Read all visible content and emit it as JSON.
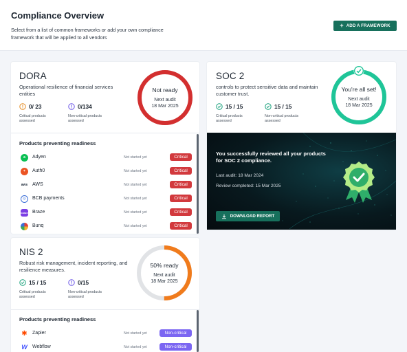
{
  "header": {
    "title": "Compliance Overview",
    "subtitle": "Select from a list of common frameworks or add your own compliance framework that will be applied to all vendors",
    "add_button": "ADD A FRAMEWORK"
  },
  "colors": {
    "accent": "#17705c",
    "critical": "#d2393d",
    "non_critical": "#7b66f2",
    "ring_red": "#d32f2f",
    "ring_green": "#1fc598",
    "ring_orange": "#f07b1c"
  },
  "frameworks": [
    {
      "name": "DORA",
      "description": "Operational resilience of financial services entities",
      "ring_status": "Not ready",
      "next_audit_label": "Next audit",
      "next_audit_date": "18 Mar 2025",
      "readiness": 0,
      "critical_value": "0/ 23",
      "critical_label": "Critical products assessed",
      "noncritical_value": "0/134",
      "noncritical_label": "Non-critical products assessed",
      "section_title": "Products preventing readiness",
      "products": [
        {
          "name": "Adyen",
          "status": "Not started yet",
          "badge": "Critical",
          "icon": "adyen-logo",
          "color": "#0abf53"
        },
        {
          "name": "Auth0",
          "status": "Not started yet",
          "badge": "Critical",
          "icon": "auth0-logo",
          "color": "#eb5424"
        },
        {
          "name": "AWS",
          "status": "Not started yet",
          "badge": "Critical",
          "icon": "aws-logo",
          "color": "#232f3e"
        },
        {
          "name": "BCB payments",
          "status": "Not started yet",
          "badge": "Critical",
          "icon": "bcb-logo",
          "color": "#3b6fd8"
        },
        {
          "name": "Braze",
          "status": "Not started yet",
          "badge": "Critical",
          "icon": "braze-logo",
          "color": "#7b3fe4"
        },
        {
          "name": "Bunq",
          "status": "Not started yet",
          "badge": "Critical",
          "icon": "bunq-logo",
          "color": "#e0413a"
        }
      ]
    },
    {
      "name": "SOC 2",
      "description": "controls to protect sensitive data and maintain customer trust.",
      "ring_status": "You're all set!",
      "next_audit_label": "Next audit",
      "next_audit_date": "18 Mar 2025",
      "readiness": 1,
      "critical_value": "15 / 15",
      "critical_label": "Critical products assessed",
      "noncritical_value": "15 / 15",
      "noncritical_label": "Non-critical products assessed",
      "success": {
        "title": "You successfully reviewed all your products for SOC 2 compliance.",
        "last_audit": "Last audit: 18 Mar 2024",
        "review_completed": "Review completed: 15 Mar 2025",
        "download_button": "DOWNLOAD REPORT"
      }
    },
    {
      "name": "NIS 2",
      "description": "Robust risk management, incident reporting, and resilience measures.",
      "ring_status": "50% ready",
      "next_audit_label": "Next audit",
      "next_audit_date": "18 Mar 2025",
      "readiness": 0.5,
      "critical_value": "15 / 15",
      "critical_label": "Critical products assessed",
      "noncritical_value": "0/15",
      "noncritical_label": "Non-critical products assessed",
      "section_title": "Products preventing readiness",
      "products": [
        {
          "name": "Zapier",
          "status": "Not started yet",
          "badge": "Non-critical",
          "icon": "zapier-logo",
          "color": "#ff4a00"
        },
        {
          "name": "Webflow",
          "status": "Not started yet",
          "badge": "Non-critical",
          "icon": "webflow-logo",
          "color": "#4353ff"
        }
      ]
    }
  ]
}
